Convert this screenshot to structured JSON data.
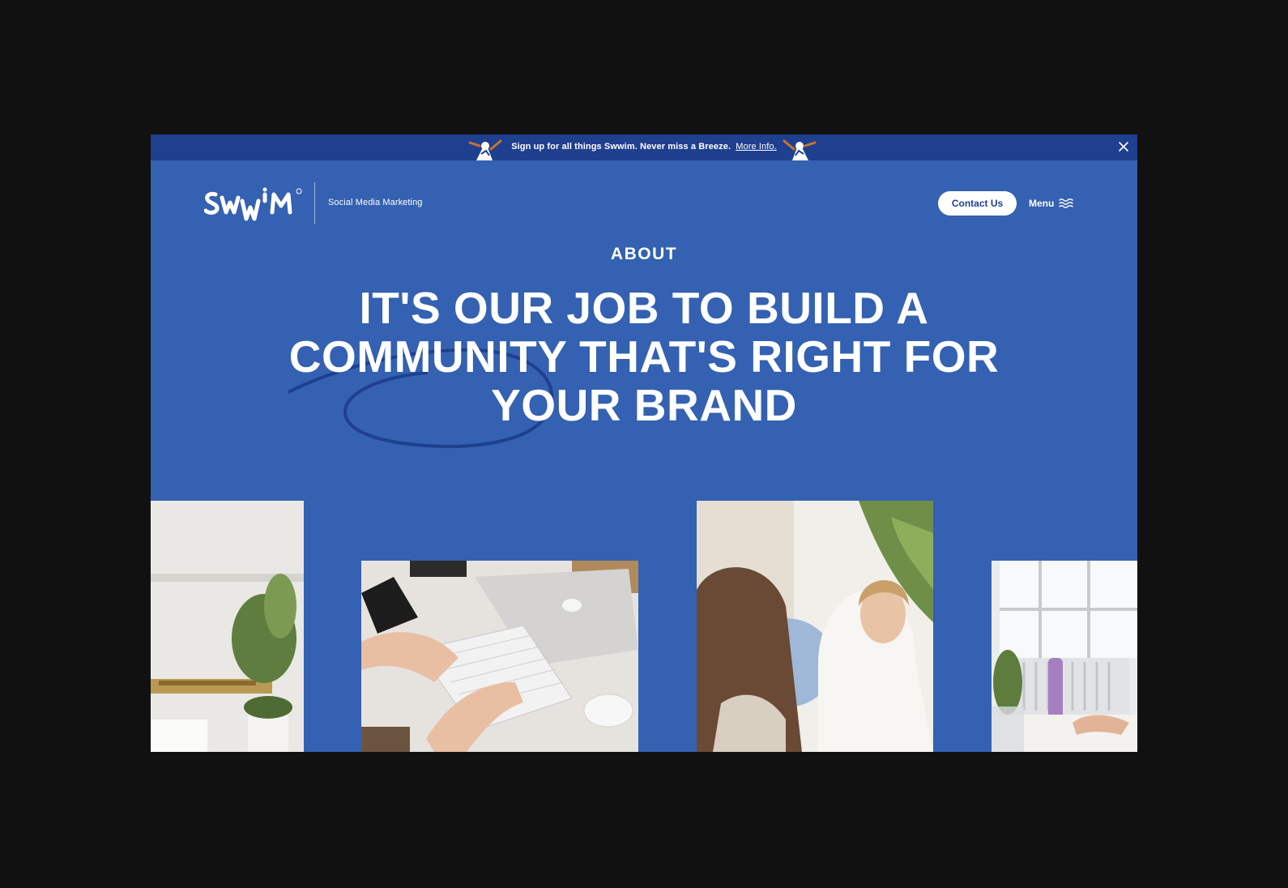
{
  "banner": {
    "text": "Sign up for all things Swwim. Never miss a Breeze.",
    "link_text": "More Info.",
    "mascot_icon": "swimmer-mascot-icon",
    "close_icon": "close-icon"
  },
  "header": {
    "logo_text": "SWWIM",
    "tagline": "Social Media Marketing",
    "contact_label": "Contact Us",
    "menu_label": "Menu",
    "menu_icon": "waves-icon"
  },
  "hero": {
    "eyebrow": "ABOUT",
    "headline": "IT'S OUR JOB TO BUILD A COMMUNITY THAT'S RIGHT FOR YOUR BRAND"
  },
  "colors": {
    "page_background": "#3461b1",
    "banner_background": "#1f3f8f",
    "scribble": "#1f3f8f",
    "text": "#ffffff",
    "outer_background": "#111111"
  }
}
